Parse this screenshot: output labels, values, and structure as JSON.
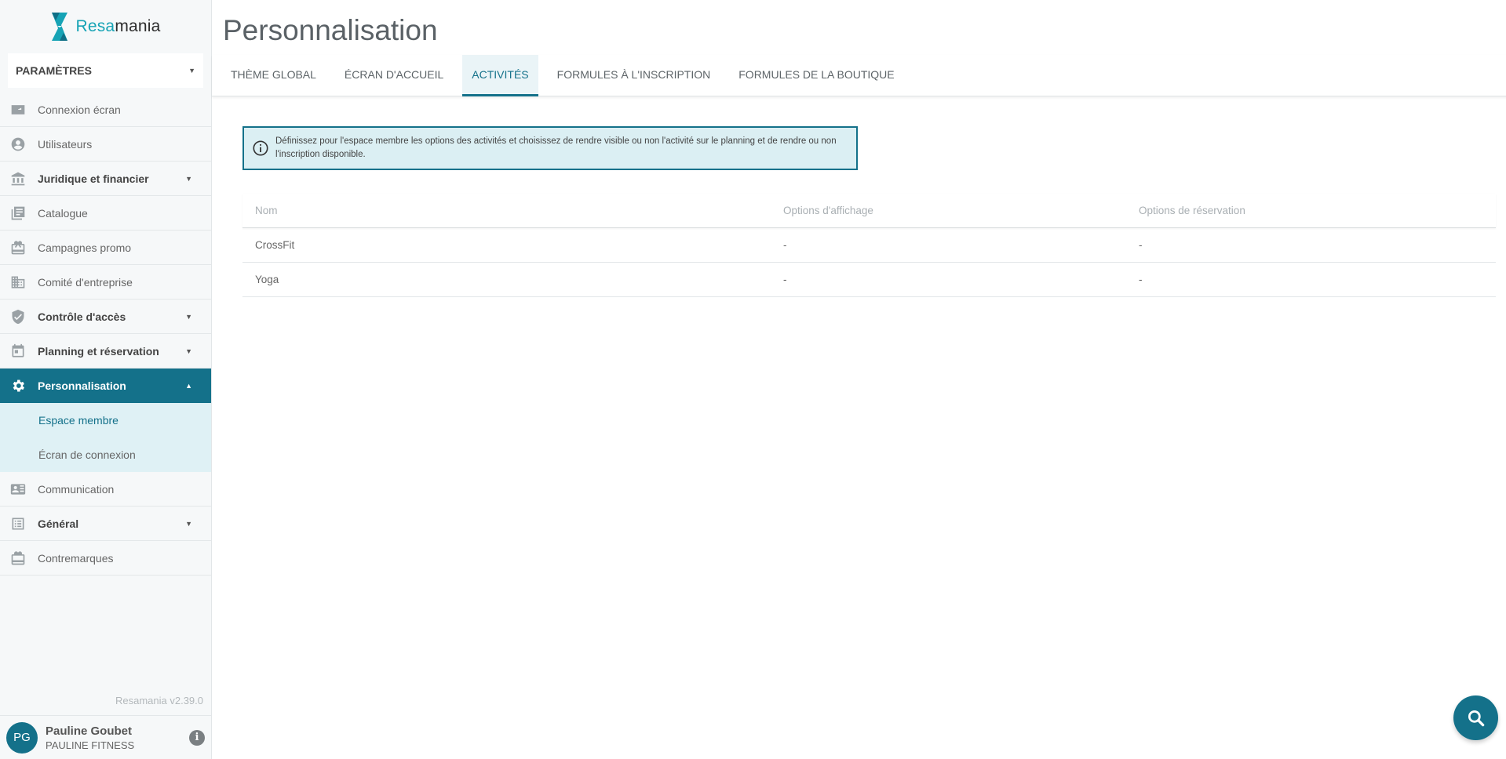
{
  "brand": {
    "name_part1": "Resa",
    "name_part2": "mania",
    "accent_color": "#16a3b5",
    "primary_color": "#14718a"
  },
  "settings_select": {
    "value": "PARAMÈTRES"
  },
  "sidebar": {
    "items": [
      {
        "label": "Connexion écran",
        "icon": "screen-login-icon"
      },
      {
        "label": "Utilisateurs",
        "icon": "user-circle-icon"
      },
      {
        "label": "Juridique et financier",
        "icon": "bank-icon",
        "expandable": true
      },
      {
        "label": "Catalogue",
        "icon": "catalog-icon"
      },
      {
        "label": "Campagnes promo",
        "icon": "gift-icon"
      },
      {
        "label": "Comité d'entreprise",
        "icon": "building-icon"
      },
      {
        "label": "Contrôle d'accès",
        "icon": "shield-check-icon",
        "expandable": true
      },
      {
        "label": "Planning et réservation",
        "icon": "calendar-icon",
        "expandable": true
      },
      {
        "label": "Personnalisation",
        "icon": "gear-icon",
        "expandable": true,
        "active": true
      },
      {
        "label": "Communication",
        "icon": "contact-card-icon"
      },
      {
        "label": "Général",
        "icon": "list-icon",
        "expandable": true
      },
      {
        "label": "Contremarques",
        "icon": "ticket-icon"
      }
    ],
    "subitems": [
      {
        "label": "Espace membre",
        "current": true
      },
      {
        "label": "Écran de connexion"
      }
    ],
    "version": "Resamania v2.39.0"
  },
  "user": {
    "initials": "PG",
    "name": "Pauline Goubet",
    "org": "PAULINE FITNESS"
  },
  "page": {
    "title": "Personnalisation"
  },
  "tabs": [
    {
      "label": "THÈME GLOBAL"
    },
    {
      "label": "ÉCRAN D'ACCUEIL"
    },
    {
      "label": "ACTIVITÉS",
      "active": true
    },
    {
      "label": "FORMULES À L'INSCRIPTION"
    },
    {
      "label": "FORMULES DE LA BOUTIQUE"
    }
  ],
  "notice": {
    "text": "Définissez pour l'espace membre les options des activités et choisissez de rendre visible ou non l'activité sur le planning et de rendre ou non l'inscription disponible.",
    "icon": "info-circle-icon"
  },
  "table": {
    "headers": [
      "Nom",
      "Options d'affichage",
      "Options de réservation"
    ],
    "rows": [
      [
        "CrossFit",
        "-",
        "-"
      ],
      [
        "Yoga",
        "-",
        "-"
      ]
    ]
  },
  "fab": {
    "icon": "search-icon"
  }
}
